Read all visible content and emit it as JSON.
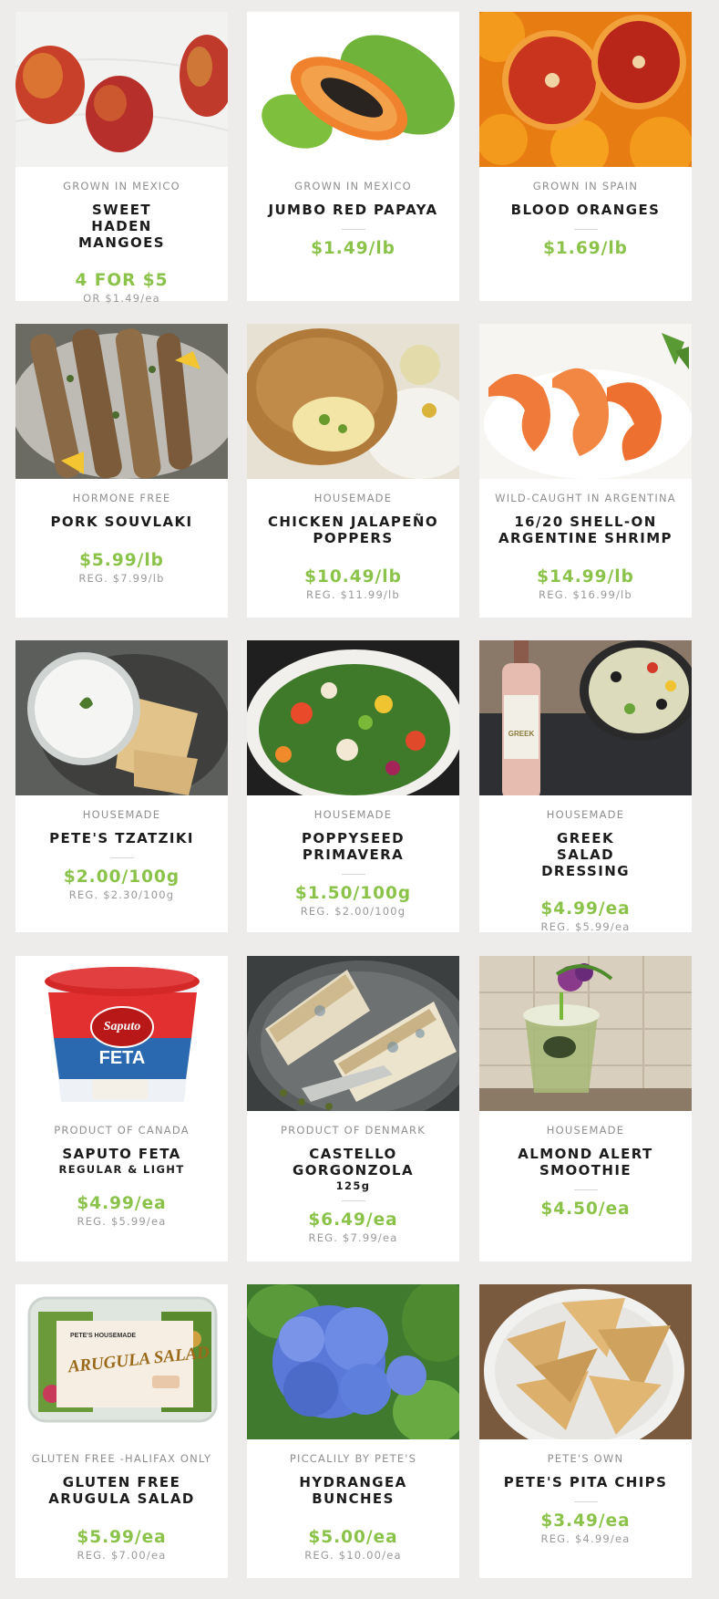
{
  "colors": {
    "price": "#8bc34a",
    "background": "#eeecea",
    "card": "#ffffff",
    "label": "#8f8f8f"
  },
  "products": [
    {
      "origin": "GROWN IN MEXICO",
      "name": "SWEET HADEN MANGOES",
      "price": "4 FOR $5",
      "reg": "OR $1.49/ea",
      "image": "mangoes-photo"
    },
    {
      "origin": "GROWN IN MEXICO",
      "name": "JUMBO RED PAPAYA",
      "price": "$1.49/lb",
      "image": "papaya-photo"
    },
    {
      "origin": "GROWN IN SPAIN",
      "name": "BLOOD ORANGES",
      "price": "$1.69/lb",
      "image": "blood-oranges-photo"
    },
    {
      "origin": "HORMONE FREE",
      "name": "PORK SOUVLAKI",
      "price": "$5.99/lb",
      "reg": "REG. $7.99/lb",
      "image": "souvlaki-photo"
    },
    {
      "origin": "HOUSEMADE",
      "name": "CHICKEN JALAPEÑO POPPERS",
      "price": "$10.49/lb",
      "reg": "REG. $11.99/lb",
      "image": "chicken-poppers-photo"
    },
    {
      "origin": "WILD-CAUGHT IN ARGENTINA",
      "name": "16/20 SHELL-ON ARGENTINE SHRIMP",
      "price": "$14.99/lb",
      "reg": "REG. $16.99/lb",
      "image": "shrimp-photo"
    },
    {
      "origin": "HOUSEMADE",
      "name": "PETE'S TZATZIKI",
      "price": "$2.00/100g",
      "reg": "REG. $2.30/100g",
      "image": "tzatziki-photo"
    },
    {
      "origin": "HOUSEMADE",
      "name": "POPPYSEED PRIMAVERA",
      "price": "$1.50/100g",
      "reg": "REG. $2.00/100g",
      "image": "primavera-salad-photo"
    },
    {
      "origin": "HOUSEMADE",
      "name": "GREEK SALAD DRESSING",
      "price": "$4.99/ea",
      "reg": "REG. $5.99/ea",
      "image": "greek-dressing-photo",
      "bottle_label": "GREEK"
    },
    {
      "origin": "PRODUCT OF CANADA",
      "name": "SAPUTO FETA",
      "sub": "REGULAR & LIGHT",
      "price": "$4.99/ea",
      "reg": "REG. $5.99/ea",
      "image": "saputo-feta-photo",
      "brand": "Saputo",
      "product_label": "FETA"
    },
    {
      "origin": "PRODUCT OF DENMARK",
      "name": "CASTELLO GORGONZOLA",
      "sub": "125g",
      "price": "$6.49/ea",
      "reg": "REG. $7.99/ea",
      "image": "gorgonzola-photo"
    },
    {
      "origin": "HOUSEMADE",
      "name": "ALMOND ALERT SMOOTHIE",
      "price": "$4.50/ea",
      "image": "smoothie-photo"
    },
    {
      "origin": "GLUTEN FREE -HALIFAX ONLY",
      "name": "GLUTEN FREE ARUGULA SALAD",
      "price": "$5.99/ea",
      "reg": "REG. $7.00/ea",
      "image": "arugula-salad-photo",
      "package_top": "PETE'S HOUSEMADE",
      "package_title": "ARUGULA SALAD"
    },
    {
      "origin": "PICCALILY BY PETE'S",
      "name": "HYDRANGEA BUNCHES",
      "price": "$5.00/ea",
      "reg": "REG. $10.00/ea",
      "image": "hydrangea-photo"
    },
    {
      "origin": "PETE'S OWN",
      "name": "PETE'S PITA CHIPS",
      "price": "$3.49/ea",
      "reg": "REG. $4.99/ea",
      "image": "pita-chips-photo"
    }
  ]
}
